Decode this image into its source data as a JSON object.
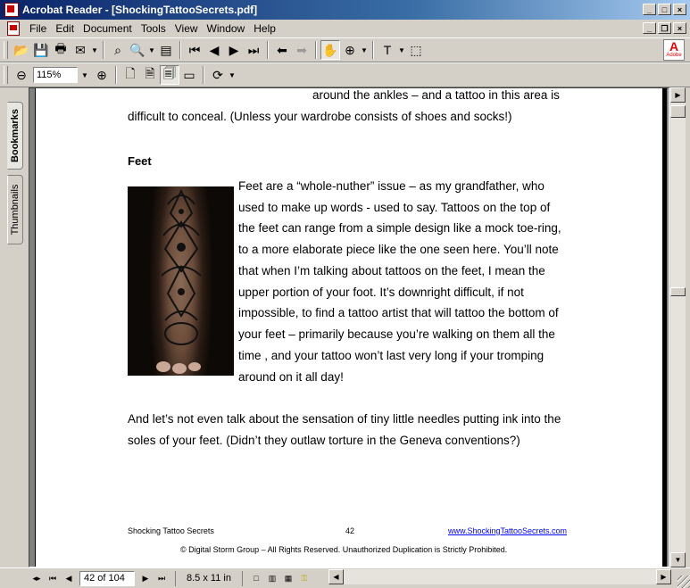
{
  "window": {
    "title": "Acrobat Reader - [ShockingTattooSecrets.pdf]"
  },
  "menu": {
    "items": [
      "File",
      "Edit",
      "Document",
      "Tools",
      "View",
      "Window",
      "Help"
    ]
  },
  "toolbar": {
    "zoom_value": "115%"
  },
  "brand": {
    "logo_text": "Adobe",
    "accent_color": "#e00000"
  },
  "side_tabs": {
    "bookmarks": "Bookmarks",
    "thumbnails": "Thumbnails"
  },
  "document": {
    "lines": [
      "around the ankles – and a tattoo in this area is",
      "difficult to conceal. (Unless your wardrobe consists of shoes and socks!)"
    ],
    "heading": "Feet",
    "paragraph_lines": [
      "Feet are a “whole-nuther” issue – as my grandfather, who",
      "used to make up words - used to say.  Tattoos on the top of",
      "the feet can range from a simple design like a mock toe-ring,",
      "to a more elaborate piece like the one seen here.  You’ll note",
      "that when I’m talking about tattoos on the feet, I mean the",
      "upper portion of your foot. It’s downright difficult, if not",
      "impossible, to find a tattoo artist that will tattoo the bottom of",
      "your feet – primarily because you’re walking on them all the",
      "time    , and your tattoo won’t last very long if your tromping",
      "around on it all day!"
    ],
    "closing_lines": [
      "And let’s not even talk about the sensation of tiny little needles putting ink into the",
      "soles of your feet.  (Didn’t they outlaw torture in the Geneva conventions?)"
    ],
    "footer": {
      "left": "Shocking Tattoo Secrets",
      "page_number": "42",
      "link": "www.ShockingTattooSecrets.com",
      "copyright": "© Digital Storm Group – All Rights Reserved.  Unauthorized Duplication is Strictly Prohibited."
    }
  },
  "status": {
    "page_field": "42 of 104",
    "page_size": "8.5 x 11 in"
  }
}
